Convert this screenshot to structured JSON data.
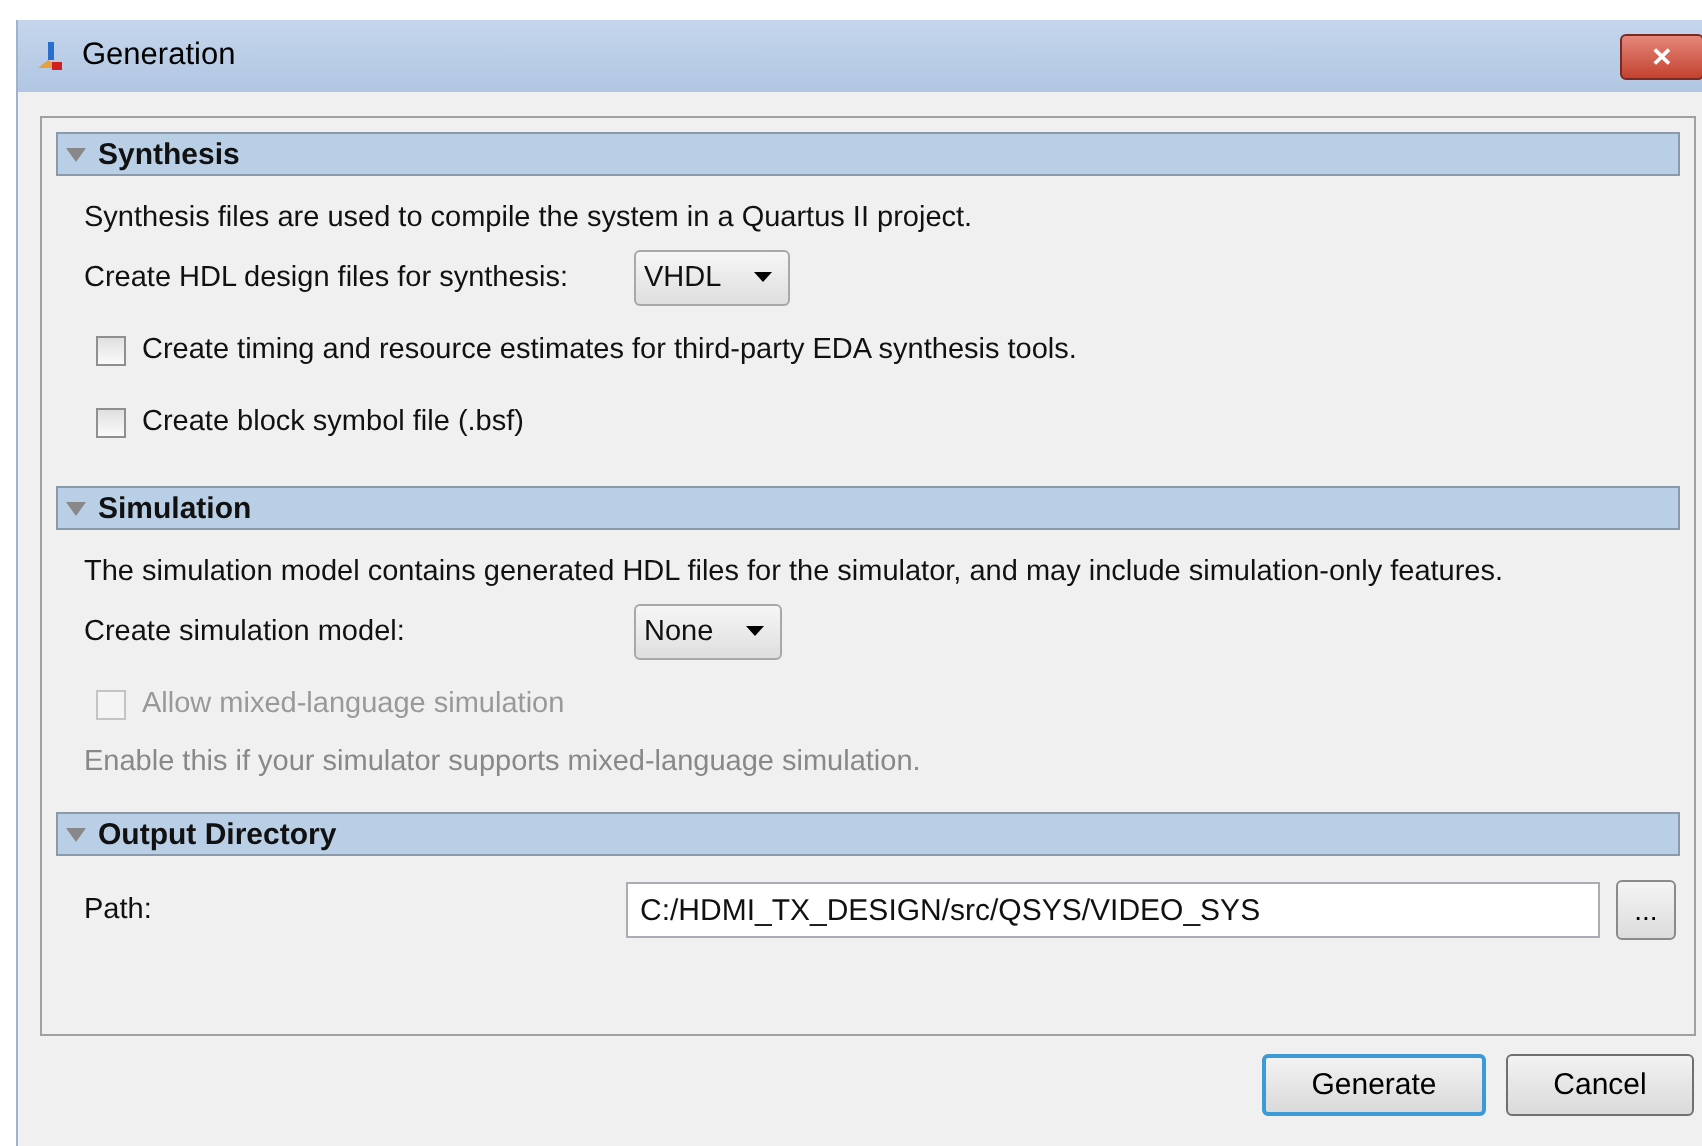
{
  "window": {
    "title": "Generation",
    "close": "✕"
  },
  "sections": [
    {
      "title": "Synthesis",
      "expanded": true,
      "rows": [
        {
          "kind": "text",
          "text": "Synthesis files are used to compile the system in a Quartus II project."
        },
        {
          "kind": "select",
          "label": "Create HDL design files for synthesis:",
          "value": "VHDL"
        },
        {
          "kind": "checkbox",
          "label": "Create timing and resource estimates for third-party EDA synthesis tools.",
          "checked": false,
          "disabled": false
        },
        {
          "kind": "checkbox",
          "label": "Create block symbol file (.bsf)",
          "checked": false,
          "disabled": false
        }
      ]
    },
    {
      "title": "Simulation",
      "expanded": true,
      "rows": [
        {
          "kind": "text",
          "text": "The simulation model contains generated HDL files for the simulator, and may include simulation-only features."
        },
        {
          "kind": "select",
          "label": "Create simulation model:",
          "value": "None"
        },
        {
          "kind": "checkbox",
          "label": "Allow mixed-language simulation",
          "checked": false,
          "disabled": true
        },
        {
          "kind": "note",
          "text": "Enable this if your simulator supports mixed-language simulation."
        }
      ]
    },
    {
      "title": "Output Directory",
      "expanded": true,
      "rows": [
        {
          "kind": "path",
          "label": "Path:",
          "value": "C:/HDMI_TX_DESIGN/src/QSYS/VIDEO_SYS",
          "browse": "..."
        }
      ]
    }
  ],
  "buttons": [
    {
      "label": "Generate",
      "default": true
    },
    {
      "label": "Cancel",
      "default": false
    }
  ]
}
